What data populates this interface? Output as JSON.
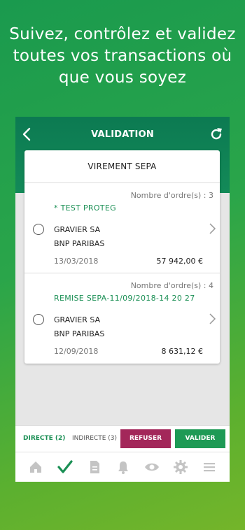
{
  "headline": [
    "Suivez, contrôlez et validez",
    "toutes vos transactions où",
    "que vous soyez"
  ],
  "app": {
    "title": "VALIDATION",
    "card_title": "VIREMENT SEPA",
    "transactions": [
      {
        "orders": "Nombre d'ordre(s) : 3",
        "label": "* TEST PROTEG",
        "name1": "GRAVIER SA",
        "name2": "BNP PARIBAS",
        "date": "13/03/2018",
        "amount": "57 942,00 €"
      },
      {
        "orders": "Nombre d'ordre(s) : 4",
        "label": "REMISE SEPA-11/09/2018-14 20 27",
        "name1": "GRAVIER SA",
        "name2": "BNP PARIBAS",
        "date": "12/09/2018",
        "amount": "8 631,12 €"
      }
    ],
    "tabs": {
      "direct": "DIRECTE (2)",
      "indirect": "INDIRECTE (3)"
    },
    "buttons": {
      "refuse": "REFUSER",
      "validate": "VALIDER"
    },
    "nav_icons": [
      "home-icon",
      "checkmark-icon",
      "document-icon",
      "bell-icon",
      "eye-icon",
      "gear-icon",
      "menu-icon"
    ]
  },
  "colors": {
    "primary_green": "#138a58",
    "accent_green": "#1a8f54",
    "refuse": "#a3275a",
    "validate": "#1e9a55"
  }
}
